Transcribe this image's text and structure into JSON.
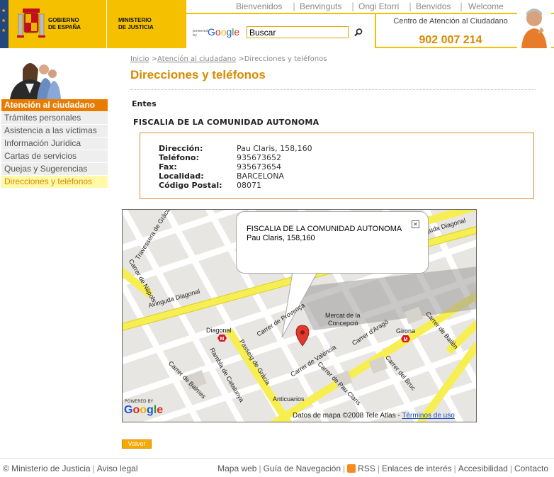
{
  "header": {
    "gov_line1": "GOBIERNO",
    "gov_line2": "DE ESPAÑA",
    "ministry_line1": "MINISTERIO",
    "ministry_line2": "DE JUSTICIA",
    "languages": [
      "Bienvenidos",
      "Benvinguts",
      "Ongi Etorri",
      "Benvidos",
      "Welcome"
    ],
    "search": {
      "powered_by": "powered by",
      "engine": "Google",
      "value": "Buscar"
    },
    "citizen_center": {
      "title": "Centro de Atención al Ciudadano",
      "phone": "902 007 214"
    }
  },
  "sidebar": {
    "title": "Atención al ciudadano",
    "items": [
      {
        "label": "Trámites personales"
      },
      {
        "label": "Asistencia a las víctimas"
      },
      {
        "label": "Información Jurídica"
      },
      {
        "label": "Cartas de servicios"
      },
      {
        "label": "Quejas y Sugerencias"
      },
      {
        "label": "Direcciones y teléfonos"
      }
    ]
  },
  "breadcrumb": {
    "home": "Inicio",
    "sep": ">",
    "level1": "Atención al ciudadano",
    "current": "Direcciones y teléfonos"
  },
  "page": {
    "title": "Direcciones y teléfonos",
    "section": "Entes",
    "entity": "FISCALIA DE LA COMUNIDAD AUTONOMA"
  },
  "details": [
    {
      "label": "Dirección:",
      "value": "Pau Claris, 158,160"
    },
    {
      "label": "Teléfono:",
      "value": "935673652"
    },
    {
      "label": "Fax:",
      "value": "935673654"
    },
    {
      "label": "Localidad:",
      "value": "BARCELONA"
    },
    {
      "label": "Código Postal:",
      "value": "08071"
    }
  ],
  "map": {
    "bubble_title": "FISCALIA DE LA COMUNIDAD AUTONOMA",
    "bubble_address": "Pau Claris, 158,160",
    "labels": {
      "diagonal_ave": "Avinguda Diagonal",
      "diagonal_metro": "Diagonal",
      "girona": "Girona",
      "mercat1": "Mercat de la",
      "mercat2": "Concepció",
      "passeig": "Passeig de Gràcia",
      "valencia": "Carrer de València",
      "arago": "Carrer d'Aragó",
      "provenca": "Carrer de Provença",
      "balmes": "Carrer de Balmes",
      "rambla": "Rambla de Catalunya",
      "anticuarios": "Anticuarios",
      "pau_claris": "Carrer de Pau Claris",
      "bruc": "Carrer del Bruc",
      "bailen": "Carrer de Bailèn",
      "napols": "Carrer de Nàpols",
      "travessera": "Travessera de Gràcia",
      "diagonal_ne": "Avinguda Diagonal"
    },
    "copyright": "Datos de mapa ©2008 Tele Atlas -",
    "terms": "Términos de uso",
    "powered_by": "POWERED BY",
    "google": "Google"
  },
  "back_button": "Volver",
  "footer": {
    "copyright": "© Ministerio de Justicia",
    "legal": "Aviso legal",
    "links": [
      "Mapa web",
      "Guía de Navegación",
      "RSS",
      "Enlaces de interés",
      "Accesibilidad",
      "Contacto"
    ]
  }
}
